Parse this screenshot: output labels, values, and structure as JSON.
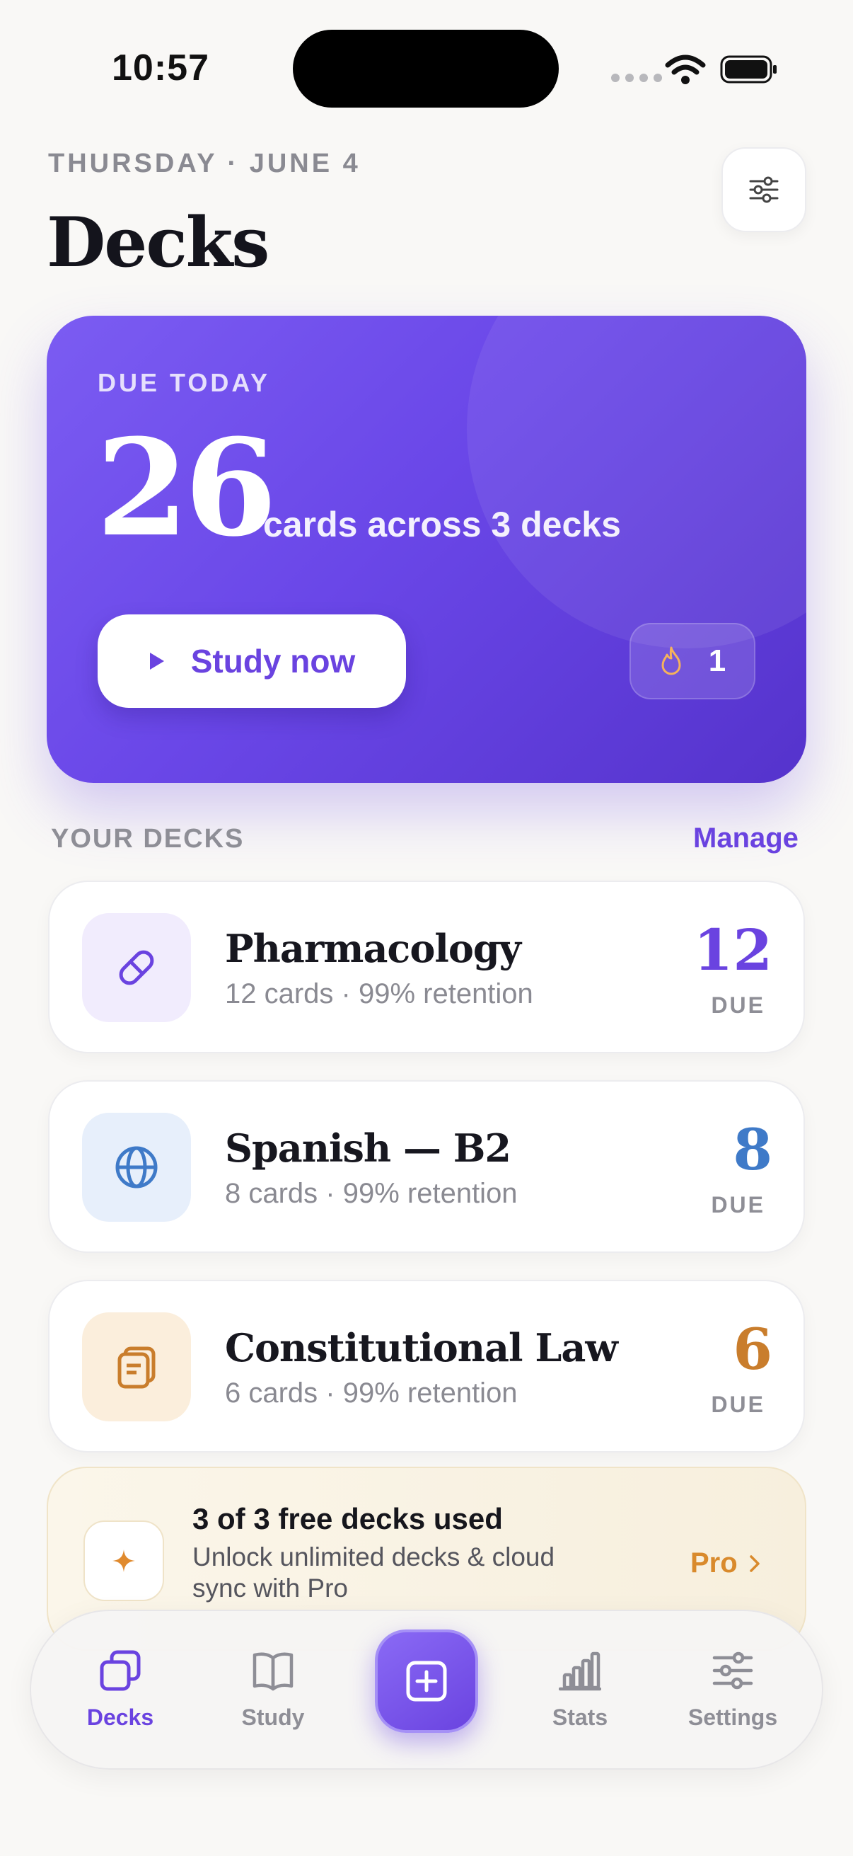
{
  "status_bar": {
    "time": "10:57"
  },
  "header": {
    "date": "THURSDAY · JUNE 4",
    "title": "Decks"
  },
  "hero": {
    "label": "DUE TODAY",
    "count": "26",
    "subtitle": "cards across 3 decks",
    "study_label": "Study now",
    "streak": "1"
  },
  "section": {
    "title": "YOUR DECKS",
    "manage": "Manage"
  },
  "decks": [
    {
      "name": "Pharmacology",
      "meta": "12 cards · 99% retention",
      "due_count": "12",
      "due_label": "DUE",
      "icon": "pill-icon",
      "color": "#6a43e0",
      "icon_bg": "#f1ecfd"
    },
    {
      "name": "Spanish — B2",
      "meta": "8 cards · 99% retention",
      "due_count": "8",
      "due_label": "DUE",
      "icon": "globe-icon",
      "color": "#3f7ac8",
      "icon_bg": "#e7effb"
    },
    {
      "name": "Constitutional Law",
      "meta": "6 cards · 99% retention",
      "due_count": "6",
      "due_label": "DUE",
      "icon": "cards-stack-icon",
      "color": "#c97d2c",
      "icon_bg": "#fbeedc"
    }
  ],
  "upsell": {
    "title": "3 of 3 free decks used",
    "body": "Unlock unlimited decks & cloud sync with Pro",
    "cta": "Pro"
  },
  "tabs": [
    {
      "label": "Decks",
      "icon": "decks-icon",
      "active": true
    },
    {
      "label": "Study",
      "icon": "book-icon",
      "active": false
    },
    {
      "label": "Stats",
      "icon": "bar-chart-icon",
      "active": false
    },
    {
      "label": "Settings",
      "icon": "sliders-icon",
      "active": false
    }
  ],
  "colors": {
    "accent": "#6a43e0",
    "background": "#f9f8f6",
    "pro": "#d98a2c"
  }
}
